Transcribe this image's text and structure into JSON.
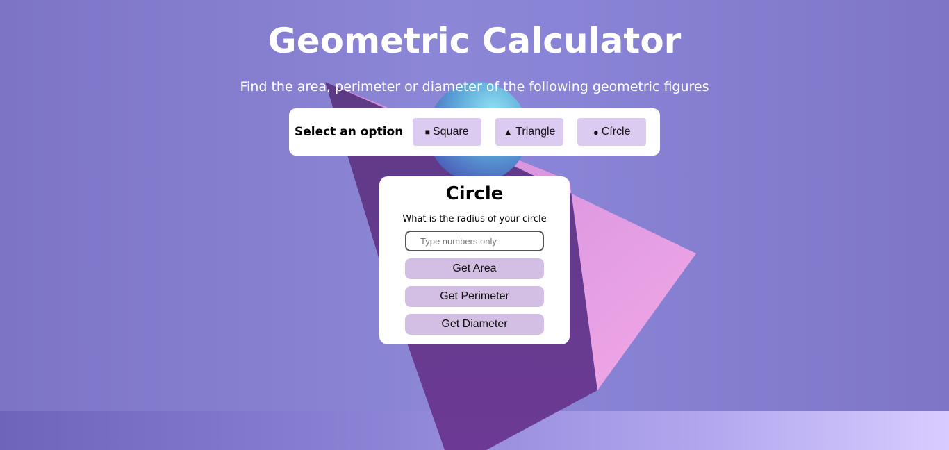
{
  "header": {
    "title": "Geometric Calculator",
    "subtitle": "Find the area, perimeter or diameter of the following geometric figures"
  },
  "options": {
    "label": "Select an option",
    "items": [
      {
        "icon": "■",
        "icon_name": "square-icon",
        "label": "Square"
      },
      {
        "icon": "▲",
        "icon_name": "triangle-icon",
        "label": "Triangle"
      },
      {
        "icon": "●",
        "icon_name": "circle-icon",
        "label": "Círcle"
      }
    ]
  },
  "card": {
    "title": "Circle",
    "question": "What is the radius of your circle",
    "input_placeholder": "Type numbers only",
    "buttons": {
      "area": "Get Area",
      "perimeter": "Get Perimeter",
      "diameter": "Get Diameter"
    }
  },
  "colors": {
    "background": "#8a84d6",
    "option_button": "#dccbf0",
    "action_button": "#d3bfe3"
  }
}
